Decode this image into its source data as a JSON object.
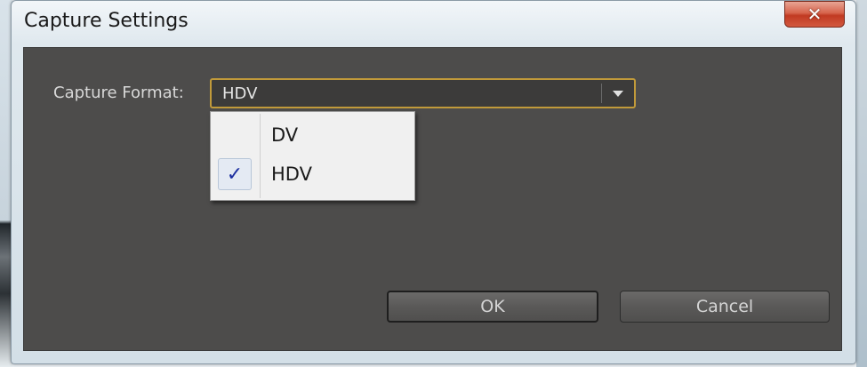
{
  "window": {
    "title": "Capture Settings",
    "close_glyph": "✕"
  },
  "form": {
    "capture_format_label": "Capture Format:",
    "capture_format_value": "HDV"
  },
  "dropdown": {
    "options": [
      {
        "label": "DV",
        "checked": false
      },
      {
        "label": "HDV",
        "checked": true
      }
    ],
    "check_glyph": "✓"
  },
  "buttons": {
    "ok_label": "OK",
    "cancel_label": "Cancel"
  },
  "colors": {
    "panel_bg": "#4d4c4b",
    "focus_border": "#c19a3a",
    "close_red": "#c13a22",
    "check_color": "#1c2fa0"
  },
  "icons": {
    "close": "close-icon",
    "dropdown_arrow": "chevron-down-icon",
    "check": "checkmark-icon"
  }
}
